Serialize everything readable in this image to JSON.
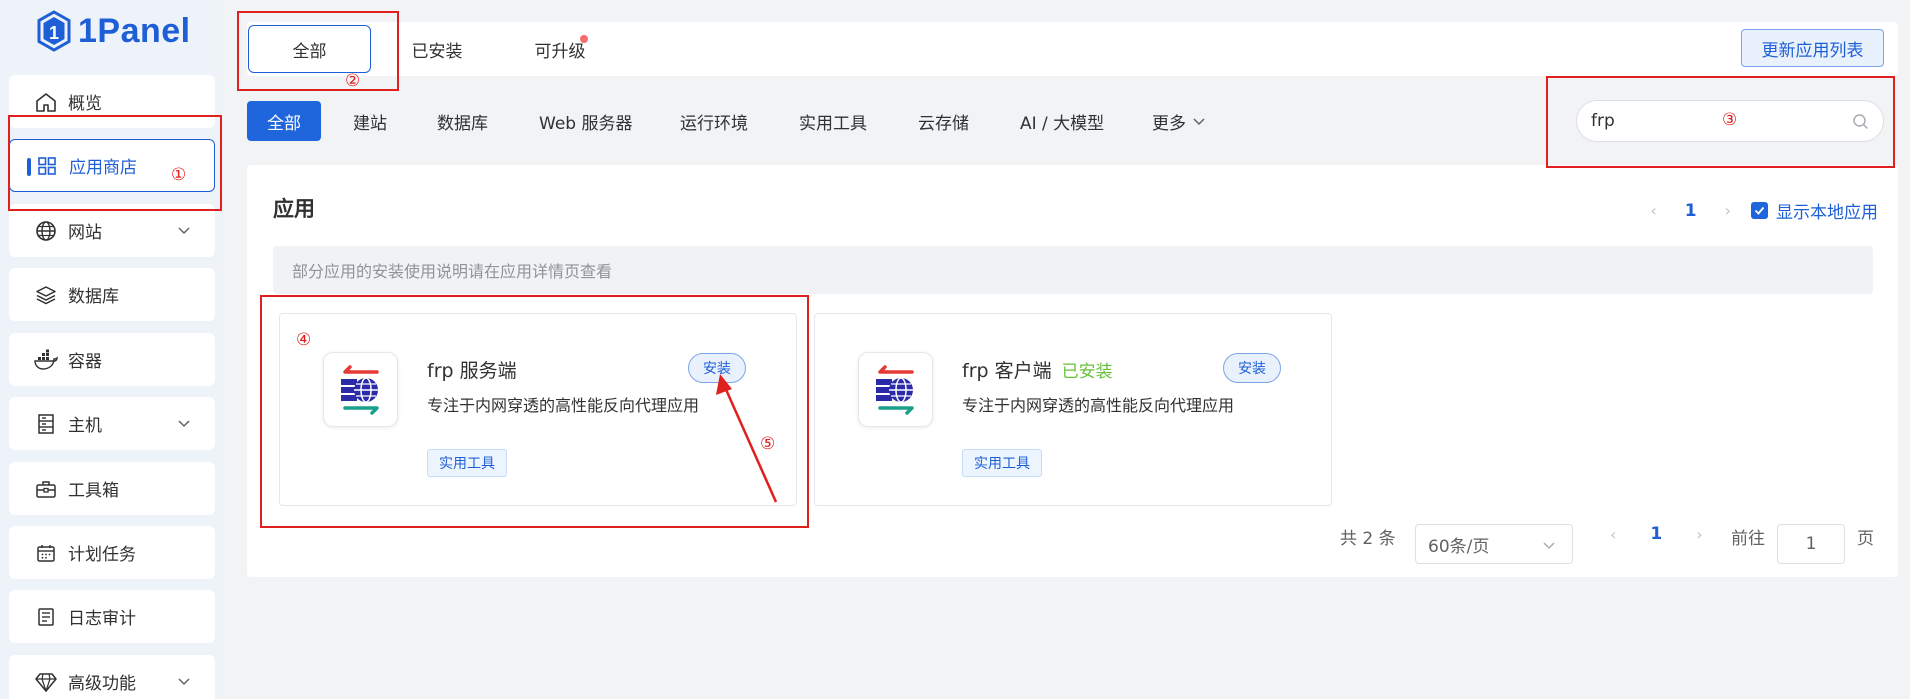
{
  "brand": {
    "name": "1Panel"
  },
  "sidebar": {
    "items": [
      {
        "label": "概览",
        "icon": "home-icon"
      },
      {
        "label": "应用商店",
        "icon": "grid-icon",
        "active": true
      },
      {
        "label": "网站",
        "icon": "globe-icon",
        "expandable": true
      },
      {
        "label": "数据库",
        "icon": "layers-icon"
      },
      {
        "label": "容器",
        "icon": "docker-icon"
      },
      {
        "label": "主机",
        "icon": "server-icon",
        "expandable": true
      },
      {
        "label": "工具箱",
        "icon": "toolbox-icon"
      },
      {
        "label": "计划任务",
        "icon": "calendar-icon"
      },
      {
        "label": "日志审计",
        "icon": "log-icon"
      },
      {
        "label": "高级功能",
        "icon": "diamond-icon",
        "expandable": true
      }
    ]
  },
  "top_tabs": [
    {
      "label": "全部",
      "active": true
    },
    {
      "label": "已安装"
    },
    {
      "label": "可升级",
      "badge_dot": true
    }
  ],
  "refresh_button": "更新应用列表",
  "categories": [
    "全部",
    "建站",
    "数据库",
    "Web 服务器",
    "运行环境",
    "实用工具",
    "云存储",
    "AI / 大模型",
    "更多"
  ],
  "search": {
    "value": "frp"
  },
  "main": {
    "title": "应用",
    "page": "1",
    "show_local_label": "显示本地应用",
    "notice": "部分应用的安装使用说明请在应用详情页查看",
    "apps": [
      {
        "name": "frp 服务端",
        "installed_label": "",
        "install_button": "安装",
        "desc": "专注于内网穿透的高性能反向代理应用",
        "tag": "实用工具"
      },
      {
        "name": "frp 客户端",
        "installed_label": "已安装",
        "install_button": "安装",
        "desc": "专注于内网穿透的高性能反向代理应用",
        "tag": "实用工具"
      }
    ],
    "pagination": {
      "total": "共 2 条",
      "page_size": "60条/页",
      "current": "1",
      "goto_label": "前往",
      "goto_value": "1",
      "page_suffix": "页"
    }
  },
  "annotations": [
    "①",
    "②",
    "③",
    "④",
    "⑤"
  ],
  "colors": {
    "accent": "#1f5fd6",
    "annotation": "#e0201e",
    "installed": "#67c23a"
  }
}
